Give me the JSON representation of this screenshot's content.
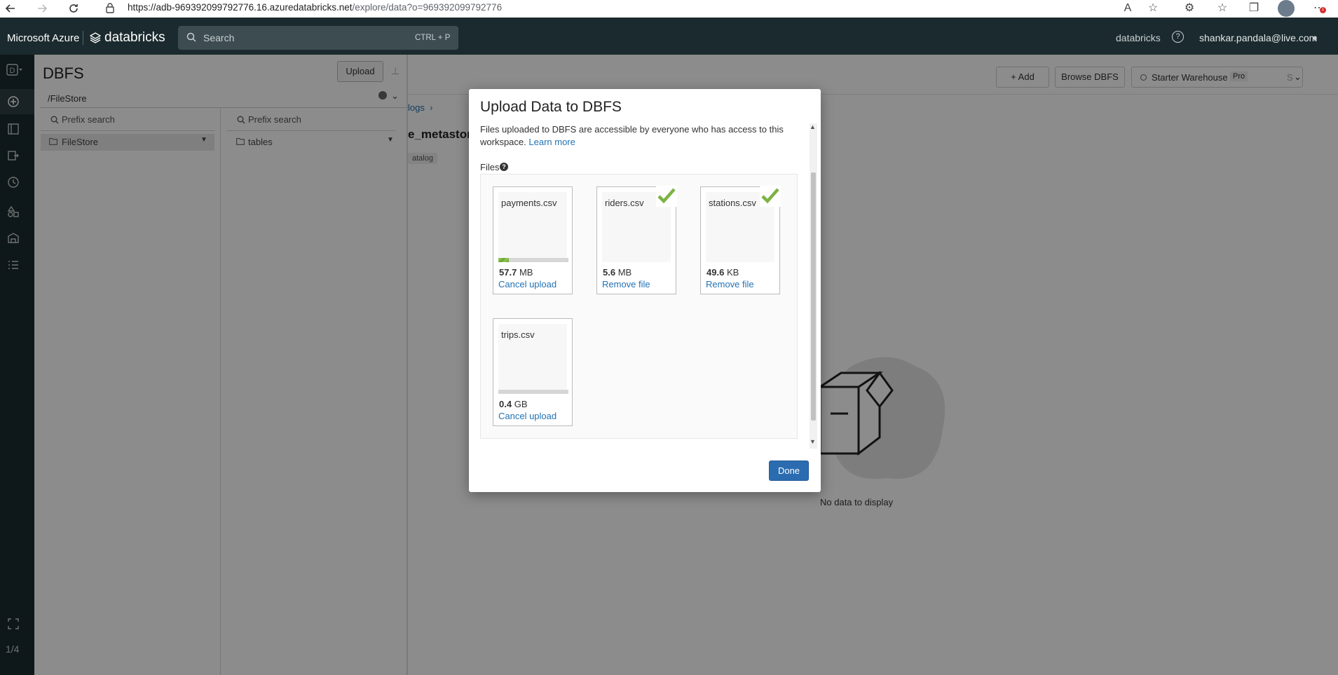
{
  "browser": {
    "url_main": "https://adb-969392099792776.16.azuredatabricks.net",
    "url_rest": "/explore/data?o=969392099792776",
    "notif_count": "1"
  },
  "topnav": {
    "brand_azure": "Microsoft Azure",
    "brand_databricks": "databricks",
    "search_placeholder": "Search",
    "search_shortcut": "CTRL + P",
    "workspace": "databricks",
    "help": "?",
    "user": "shankar.pandala@live.com"
  },
  "sidebar": {
    "workspace_badge": "D",
    "page_indicator": "1/4"
  },
  "dbfs_panel": {
    "title": "DBFS",
    "upload_label": "Upload",
    "path": "/FileStore",
    "columns": [
      {
        "search_placeholder": "Prefix search",
        "item": "FileStore"
      },
      {
        "search_placeholder": "Prefix search",
        "item": "tables"
      }
    ]
  },
  "main": {
    "add_label": "Add",
    "browse_label": "Browse DBFS",
    "warehouse_label": "Starter Warehouse",
    "warehouse_tier": "Pro",
    "warehouse_suffix": "S",
    "breadcrumb": "logs",
    "metastore_title": "e_metastor",
    "catalog_badge": "atalog",
    "empty_text": "No data to display"
  },
  "modal": {
    "title": "Upload Data to DBFS",
    "description": "Files uploaded to DBFS are accessible by everyone who has access to this workspace.",
    "learn_more": "Learn more",
    "files_label": "Files",
    "done_label": "Done",
    "files": [
      {
        "name": "payments.csv",
        "size_value": "57.7",
        "size_unit": "MB",
        "action": "Cancel upload",
        "status": "uploading",
        "progress": 0.15
      },
      {
        "name": "riders.csv",
        "size_value": "5.6",
        "size_unit": "MB",
        "action": "Remove file",
        "status": "complete"
      },
      {
        "name": "stations.csv",
        "size_value": "49.6",
        "size_unit": "KB",
        "action": "Remove file",
        "status": "complete"
      },
      {
        "name": "trips.csv",
        "size_value": "0.4",
        "size_unit": "GB",
        "action": "Cancel upload",
        "status": "uploading",
        "progress": 0.0
      }
    ]
  },
  "colors": {
    "nav_bg": "#1b2a2e",
    "link": "#2272b4",
    "done_button": "#2b6cb0",
    "success_check": "#7cb342"
  }
}
